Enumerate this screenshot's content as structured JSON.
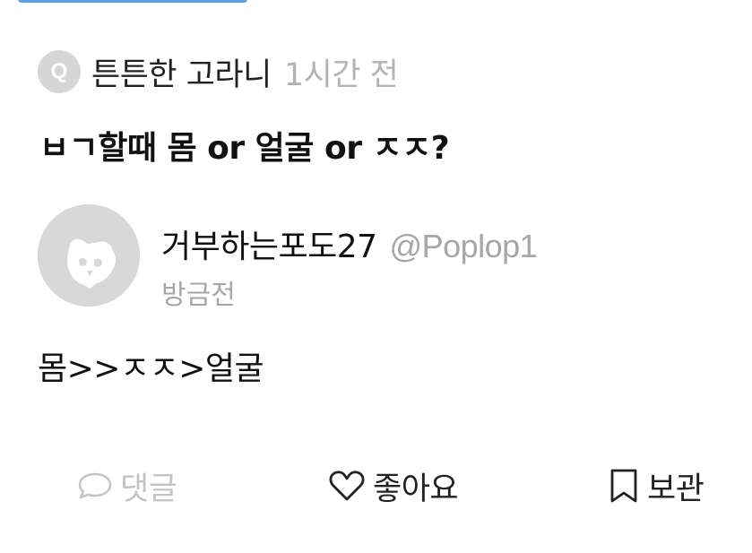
{
  "question": {
    "badge": "Q",
    "author": "튼튼한 고라니",
    "time": "1시간 전",
    "text": "ㅂㄱ할때 몸 or 얼굴 or ㅈㅈ?"
  },
  "answer": {
    "name": "거부하는포도27",
    "handle": "@Poplop1",
    "time": "방금전",
    "text": "몸>>ㅈㅈ>얼굴"
  },
  "actions": {
    "comment": "댓글",
    "like": "좋아요",
    "save": "보관"
  },
  "colors": {
    "accent_bar": "#5aa0f2",
    "muted": "#a6a6a6",
    "disabled": "#c4c4c4"
  },
  "icons": [
    "comment-icon",
    "heart-icon",
    "bookmark-icon",
    "default-avatar-icon"
  ]
}
